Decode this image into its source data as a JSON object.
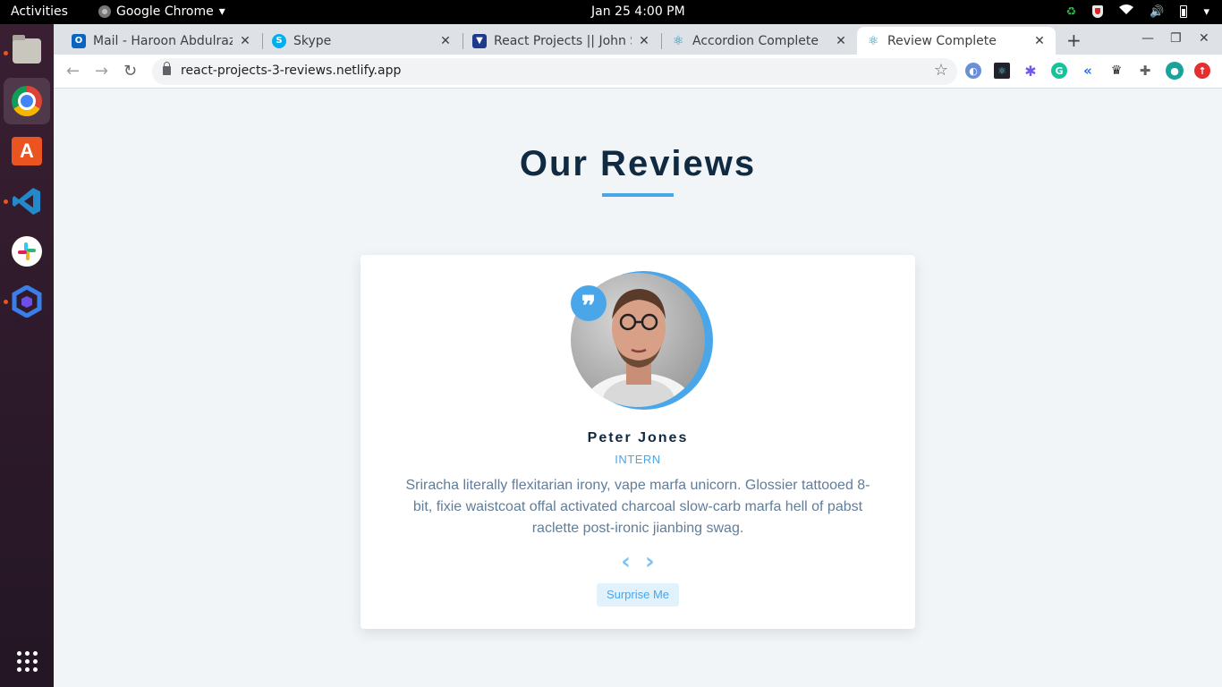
{
  "system": {
    "activities": "Activities",
    "app_name": "Google Chrome",
    "clock": "Jan 25   4:00 PM"
  },
  "browser": {
    "tabs": [
      {
        "title": "Mail - Haroon Abdulrazaq",
        "favicon": "outlook-icon"
      },
      {
        "title": "Skype",
        "favicon": "skype-icon"
      },
      {
        "title": "React Projects || John Smilga",
        "favicon": "react-projects-icon"
      },
      {
        "title": "Accordion Complete",
        "favicon": "react-icon"
      },
      {
        "title": "Review Complete",
        "favicon": "react-icon",
        "active": true
      }
    ],
    "new_tab": "+",
    "url": "react-projects-3-reviews.netlify.app"
  },
  "page": {
    "title": "Our Reviews",
    "review": {
      "name": "Peter Jones",
      "job": "INTERN",
      "text": "Sriracha literally flexitarian irony, vape marfa unicorn. Glossier tattooed 8-bit, fixie waistcoat offal activated charcoal slow-carb marfa hell of pabst raclette post-ironic jianbing swag.",
      "quote_icon": "❞"
    },
    "prev_label": "‹",
    "next_label": "›",
    "surprise_label": "Surprise Me"
  },
  "colors": {
    "primary": "#49a6e9",
    "heading": "#102a42",
    "text": "#617d98",
    "background": "#f1f5f8"
  }
}
